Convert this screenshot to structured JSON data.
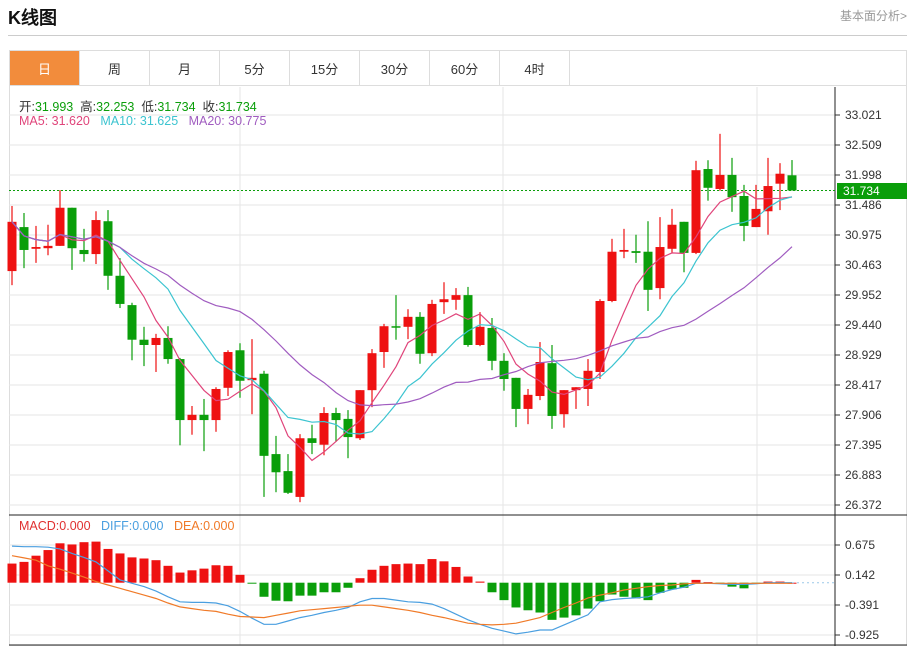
{
  "header": {
    "title": "K线图",
    "fundamental_link": "基本面分析>"
  },
  "tabs": [
    {
      "label": "日",
      "active": true
    },
    {
      "label": "周"
    },
    {
      "label": "月"
    },
    {
      "label": "5分"
    },
    {
      "label": "15分"
    },
    {
      "label": "30分"
    },
    {
      "label": "60分"
    },
    {
      "label": "4时"
    }
  ],
  "legend": {
    "open_label": "开:",
    "open": "31.993",
    "high_label": "高:",
    "high": "32.253",
    "low_label": "低:",
    "low": "31.734",
    "close_label": "收:",
    "close": "31.734",
    "ma5": "MA5: 31.620",
    "ma10": "MA10: 31.625",
    "ma20": "MA20: 30.775",
    "macd": "MACD:0.000",
    "diff": "DIFF:0.000",
    "dea": "DEA:0.000"
  },
  "current_price": "31.734",
  "colors": {
    "up": "#ee1111",
    "down": "#0a9e0a",
    "ma5": "#e0457b",
    "ma10": "#3cc4d0",
    "ma20": "#a05cc0",
    "diff": "#4a9fe0",
    "dea": "#f07a28",
    "accent": "#f28c3c"
  },
  "chart_data": {
    "type": "candlestick",
    "price_axis": {
      "ticks": [
        "33.021",
        "32.509",
        "31.998",
        "31.486",
        "30.975",
        "30.463",
        "29.952",
        "29.440",
        "28.929",
        "28.417",
        "27.906",
        "27.395",
        "26.883",
        "26.372"
      ],
      "range": [
        26.372,
        33.021
      ]
    },
    "macd_axis": {
      "ticks": [
        "0.675",
        "0.142",
        "-0.391",
        "-0.925"
      ]
    },
    "candles_ohlc": [
      [
        30.36,
        31.47,
        30.12,
        31.2
      ],
      [
        31.11,
        31.35,
        30.41,
        30.72
      ],
      [
        30.74,
        31.13,
        30.5,
        30.77
      ],
      [
        30.75,
        31.15,
        30.63,
        30.79
      ],
      [
        30.79,
        31.74,
        30.79,
        31.44
      ],
      [
        31.44,
        31.44,
        30.38,
        30.75
      ],
      [
        30.72,
        31.08,
        30.52,
        30.65
      ],
      [
        30.65,
        31.38,
        30.48,
        31.23
      ],
      [
        31.21,
        31.4,
        30.04,
        30.28
      ],
      [
        30.28,
        30.58,
        29.73,
        29.8
      ],
      [
        29.78,
        29.82,
        28.84,
        29.19
      ],
      [
        29.19,
        29.41,
        28.74,
        29.1
      ],
      [
        29.1,
        29.29,
        28.64,
        29.22
      ],
      [
        29.22,
        29.42,
        28.78,
        28.86
      ],
      [
        28.86,
        28.88,
        27.39,
        27.82
      ],
      [
        27.82,
        28.06,
        27.57,
        27.91
      ],
      [
        27.91,
        28.18,
        27.29,
        27.82
      ],
      [
        27.82,
        28.38,
        27.62,
        28.35
      ],
      [
        28.37,
        29.01,
        28.23,
        28.98
      ],
      [
        29.01,
        29.13,
        28.2,
        28.49
      ],
      [
        28.5,
        29.2,
        27.92,
        28.54
      ],
      [
        28.61,
        28.66,
        26.51,
        27.21
      ],
      [
        27.24,
        27.55,
        26.59,
        26.93
      ],
      [
        26.95,
        27.24,
        26.56,
        26.58
      ],
      [
        26.51,
        27.58,
        26.42,
        27.51
      ],
      [
        27.51,
        27.74,
        27.24,
        27.43
      ],
      [
        27.4,
        28.04,
        27.22,
        27.94
      ],
      [
        27.94,
        28.03,
        27.45,
        27.82
      ],
      [
        27.84,
        27.99,
        27.17,
        27.53
      ],
      [
        27.51,
        28.33,
        27.48,
        28.33
      ],
      [
        28.33,
        29.03,
        28.04,
        28.96
      ],
      [
        28.98,
        29.46,
        28.71,
        29.42
      ],
      [
        29.42,
        29.95,
        29.19,
        29.41
      ],
      [
        29.41,
        29.71,
        29.2,
        29.58
      ],
      [
        29.58,
        29.66,
        28.78,
        28.95
      ],
      [
        28.96,
        29.87,
        28.91,
        29.8
      ],
      [
        29.83,
        30.17,
        29.63,
        29.88
      ],
      [
        29.87,
        30.07,
        29.7,
        29.95
      ],
      [
        29.95,
        30.09,
        29.07,
        29.1
      ],
      [
        29.1,
        29.66,
        29.08,
        29.41
      ],
      [
        29.39,
        29.56,
        28.67,
        28.83
      ],
      [
        28.83,
        28.96,
        28.32,
        28.52
      ],
      [
        28.54,
        28.54,
        27.7,
        28.01
      ],
      [
        28.01,
        28.35,
        27.75,
        28.25
      ],
      [
        28.23,
        29.15,
        28.16,
        28.81
      ],
      [
        28.79,
        29.1,
        27.67,
        27.89
      ],
      [
        27.92,
        28.33,
        27.69,
        28.33
      ],
      [
        28.33,
        28.38,
        28.01,
        28.38
      ],
      [
        28.35,
        28.86,
        28.06,
        28.66
      ],
      [
        28.64,
        29.88,
        28.52,
        29.85
      ],
      [
        29.85,
        30.91,
        29.83,
        30.69
      ],
      [
        30.69,
        31.08,
        30.58,
        30.72
      ],
      [
        30.7,
        30.98,
        30.5,
        30.67
      ],
      [
        30.69,
        31.21,
        29.68,
        30.04
      ],
      [
        30.07,
        31.28,
        29.88,
        30.77
      ],
      [
        30.74,
        31.42,
        30.67,
        31.15
      ],
      [
        31.2,
        31.2,
        30.34,
        30.67
      ],
      [
        30.67,
        32.24,
        30.65,
        32.08
      ],
      [
        32.1,
        32.25,
        31.56,
        31.78
      ],
      [
        31.76,
        32.7,
        31.73,
        32.0
      ],
      [
        32.0,
        32.29,
        31.37,
        31.62
      ],
      [
        31.64,
        31.83,
        30.87,
        31.13
      ],
      [
        31.11,
        31.83,
        31.11,
        31.42
      ],
      [
        31.38,
        32.29,
        30.98,
        31.81
      ],
      [
        31.85,
        32.2,
        31.4,
        32.02
      ],
      [
        31.993,
        32.253,
        31.734,
        31.734
      ]
    ],
    "macd_hist": [
      0.34,
      0.37,
      0.48,
      0.58,
      0.7,
      0.68,
      0.72,
      0.73,
      0.6,
      0.52,
      0.45,
      0.43,
      0.4,
      0.3,
      0.18,
      0.22,
      0.25,
      0.31,
      0.3,
      0.14,
      -0.01,
      -0.25,
      -0.32,
      -0.33,
      -0.23,
      -0.23,
      -0.17,
      -0.17,
      -0.09,
      0.08,
      0.23,
      0.3,
      0.33,
      0.34,
      0.33,
      0.42,
      0.38,
      0.28,
      0.11,
      0.02,
      -0.17,
      -0.31,
      -0.44,
      -0.49,
      -0.53,
      -0.66,
      -0.62,
      -0.58,
      -0.46,
      -0.33,
      -0.21,
      -0.25,
      -0.28,
      -0.31,
      -0.18,
      -0.12,
      -0.09,
      0.05,
      0.01,
      -0.01,
      -0.07,
      -0.1,
      -0.02,
      0.02,
      0.02,
      0.0
    ],
    "diff": [
      0.65,
      0.64,
      0.64,
      0.63,
      0.6,
      0.52,
      0.45,
      0.37,
      0.21,
      0.05,
      -0.01,
      -0.07,
      -0.15,
      -0.25,
      -0.34,
      -0.35,
      -0.35,
      -0.36,
      -0.41,
      -0.51,
      -0.63,
      -0.74,
      -0.74,
      -0.68,
      -0.62,
      -0.58,
      -0.53,
      -0.49,
      -0.44,
      -0.34,
      -0.28,
      -0.28,
      -0.31,
      -0.34,
      -0.35,
      -0.38,
      -0.46,
      -0.56,
      -0.66,
      -0.74,
      -0.81,
      -0.86,
      -0.91,
      -0.88,
      -0.84,
      -0.84,
      -0.75,
      -0.66,
      -0.57,
      -0.34,
      -0.3,
      -0.28,
      -0.27,
      -0.25,
      -0.18,
      -0.12,
      -0.08,
      -0.01,
      -0.01,
      -0.02,
      -0.03,
      -0.03,
      -0.02,
      0.0,
      0.0,
      0.0
    ],
    "dea": [
      0.48,
      0.44,
      0.4,
      0.3,
      0.24,
      0.17,
      0.1,
      0.02,
      -0.04,
      -0.1,
      -0.16,
      -0.22,
      -0.28,
      -0.36,
      -0.43,
      -0.46,
      -0.49,
      -0.51,
      -0.56,
      -0.6,
      -0.61,
      -0.62,
      -0.58,
      -0.54,
      -0.5,
      -0.48,
      -0.46,
      -0.44,
      -0.42,
      -0.4,
      -0.4,
      -0.43,
      -0.46,
      -0.49,
      -0.53,
      -0.58,
      -0.62,
      -0.67,
      -0.72,
      -0.74,
      -0.75,
      -0.74,
      -0.72,
      -0.67,
      -0.62,
      -0.53,
      -0.44,
      -0.36,
      -0.27,
      -0.22,
      -0.18,
      -0.13,
      -0.1,
      -0.07,
      -0.05,
      -0.04,
      -0.02,
      -0.01,
      -0.01,
      -0.01,
      -0.01,
      -0.01,
      -0.01,
      -0.01,
      -0.01,
      -0.01
    ],
    "moving_averages": [
      5,
      10,
      20
    ]
  }
}
